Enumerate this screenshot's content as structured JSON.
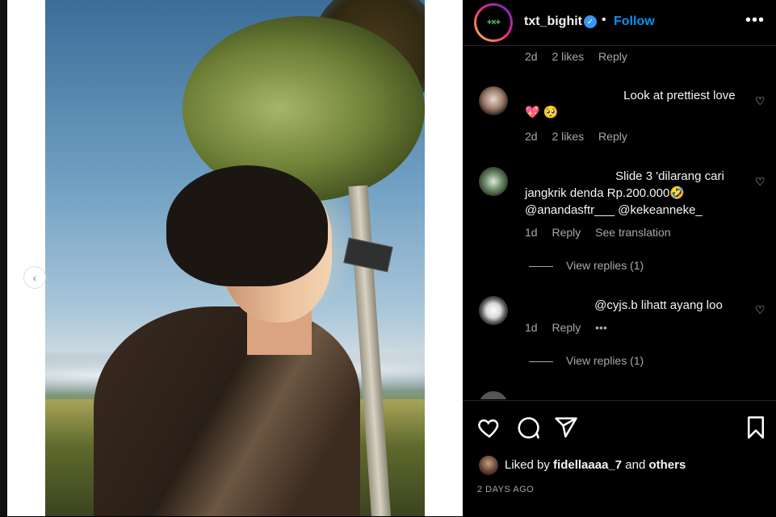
{
  "post": {
    "username": "txt_bighit",
    "avatar_logo": "+×+",
    "follow_label": "Follow",
    "dot": "•",
    "more_label": "•••",
    "verified_mark": "✓"
  },
  "media": {
    "prev_label": "‹"
  },
  "comments": [
    {
      "meta_time": "2d",
      "meta_likes": "2 likes",
      "meta_reply": "Reply"
    },
    {
      "text": "Look at prettiest love💖 🥺",
      "meta_time": "2d",
      "meta_likes": "2 likes",
      "meta_reply": "Reply"
    },
    {
      "text": "Slide 3 'dilarang cari jangkrik denda Rp.200.000🤣 @anandasftr___ @kekeanneke_",
      "meta_time": "1d",
      "meta_reply": "Reply",
      "meta_translate": "See translation",
      "replies": "View replies (1)"
    },
    {
      "text": "@cyjs.b lihatt ayang loo",
      "meta_time": "1d",
      "meta_reply": "Reply",
      "meta_more": "•••",
      "replies": "View replies (1)"
    }
  ],
  "likes": {
    "prefix": "Liked by",
    "user": "fidellaaaa_7",
    "and": "and",
    "others": "others"
  },
  "date_label": "2 DAYS AGO",
  "icons": [
    "heart-icon",
    "comment-icon",
    "share-icon",
    "bookmark-icon"
  ],
  "colors": {
    "accent": "#0095f6",
    "verified": "#3897f0",
    "panel_bg": "#000000",
    "muted": "#a8a8a8"
  }
}
